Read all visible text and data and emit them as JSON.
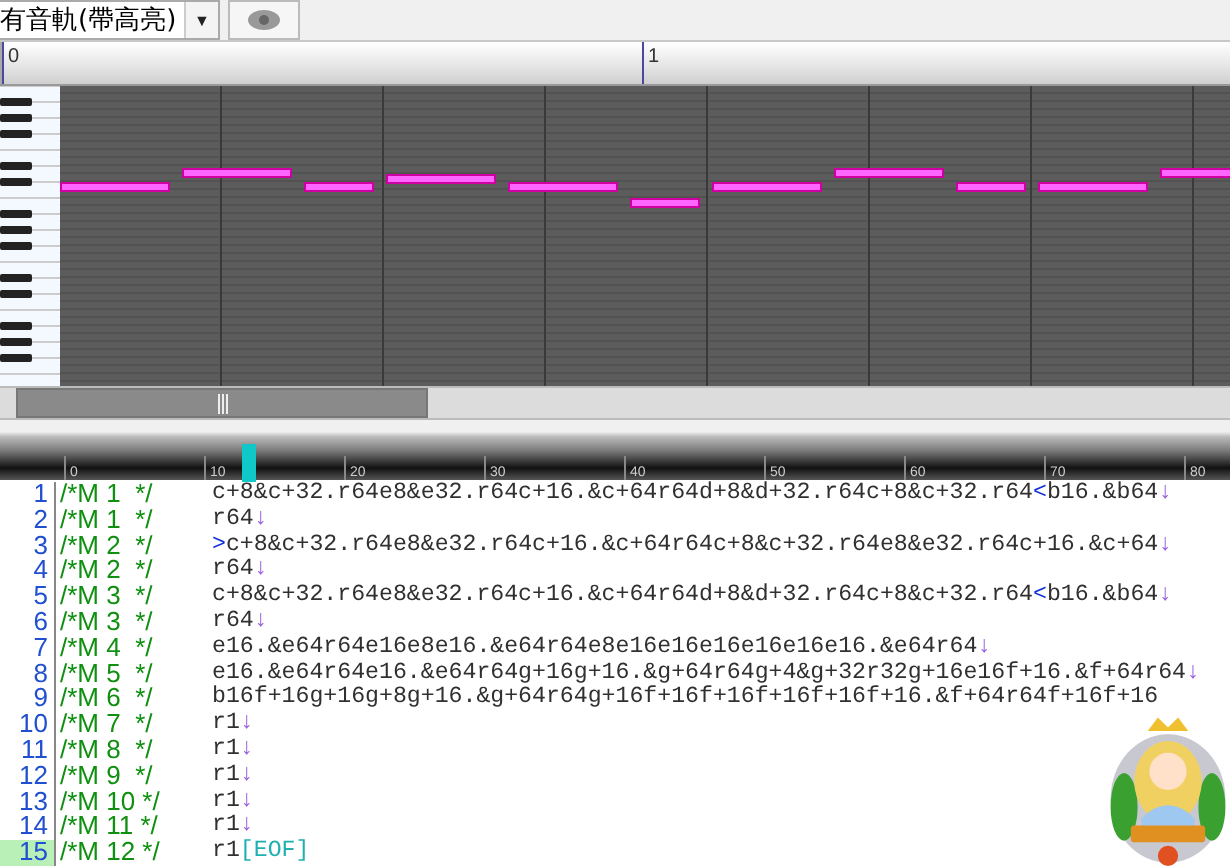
{
  "toolbar": {
    "track_filter": "有音軌(帶高亮)",
    "dropdown_arrow": "▼"
  },
  "piano_roll": {
    "measures": [
      "0",
      "1"
    ]
  },
  "editor": {
    "ruler": [
      "0",
      "10",
      "20",
      "30",
      "40",
      "50",
      "60",
      "70",
      "80"
    ],
    "lines": [
      {
        "number": "1",
        "comment": "/*M 1  */",
        "selected": false,
        "segments": [
          {
            "kind": "mml",
            "text": "c+8&c+32.r64e8&e32.r64c+16.&c+64r64d+8&d+32.r64c+8&c+32.r64"
          },
          {
            "kind": "octave",
            "text": "<"
          },
          {
            "kind": "mml",
            "text": "b16.&b64"
          },
          {
            "kind": "eol",
            "text": "↓"
          }
        ]
      },
      {
        "number": "2",
        "comment": "/*M 1  */",
        "selected": false,
        "segments": [
          {
            "kind": "mml",
            "text": "r64"
          },
          {
            "kind": "eol",
            "text": "↓"
          }
        ]
      },
      {
        "number": "3",
        "comment": "/*M 2  */",
        "selected": false,
        "segments": [
          {
            "kind": "octave",
            "text": ">"
          },
          {
            "kind": "mml",
            "text": "c+8&c+32.r64e8&e32.r64c+16.&c+64r64c+8&c+32.r64e8&e32.r64c+16.&c+64"
          },
          {
            "kind": "eol",
            "text": "↓"
          }
        ]
      },
      {
        "number": "4",
        "comment": "/*M 2  */",
        "selected": false,
        "segments": [
          {
            "kind": "mml",
            "text": "r64"
          },
          {
            "kind": "eol",
            "text": "↓"
          }
        ]
      },
      {
        "number": "5",
        "comment": "/*M 3  */",
        "selected": false,
        "segments": [
          {
            "kind": "mml",
            "text": "c+8&c+32.r64e8&e32.r64c+16.&c+64r64d+8&d+32.r64c+8&c+32.r64"
          },
          {
            "kind": "octave",
            "text": "<"
          },
          {
            "kind": "mml",
            "text": "b16.&b64"
          },
          {
            "kind": "eol",
            "text": "↓"
          }
        ]
      },
      {
        "number": "6",
        "comment": "/*M 3  */",
        "selected": false,
        "segments": [
          {
            "kind": "mml",
            "text": "r64"
          },
          {
            "kind": "eol",
            "text": "↓"
          }
        ]
      },
      {
        "number": "7",
        "comment": "/*M 4  */",
        "selected": false,
        "segments": [
          {
            "kind": "mml",
            "text": "e16.&e64r64e16e8e16.&e64r64e8e16e16e16e16e16e16.&e64r64"
          },
          {
            "kind": "eol",
            "text": "↓"
          }
        ]
      },
      {
        "number": "8",
        "comment": "/*M 5  */",
        "selected": false,
        "segments": [
          {
            "kind": "mml",
            "text": "e16.&e64r64e16.&e64r64g+16g+16.&g+64r64g+4&g+32r32g+16e16f+16.&f+64r64"
          },
          {
            "kind": "eol",
            "text": "↓"
          }
        ]
      },
      {
        "number": "9",
        "comment": "/*M 6  */",
        "selected": false,
        "segments": [
          {
            "kind": "mml",
            "text": "b16f+16g+16g+8g+16.&g+64r64g+16f+16f+16f+16f+16f+16.&f+64r64f+16f+16"
          }
        ]
      },
      {
        "number": "10",
        "comment": "/*M 7  */",
        "selected": false,
        "segments": [
          {
            "kind": "mml",
            "text": "r1"
          },
          {
            "kind": "eol",
            "text": "↓"
          }
        ]
      },
      {
        "number": "11",
        "comment": "/*M 8  */",
        "selected": false,
        "segments": [
          {
            "kind": "mml",
            "text": "r1"
          },
          {
            "kind": "eol",
            "text": "↓"
          }
        ]
      },
      {
        "number": "12",
        "comment": "/*M 9  */",
        "selected": false,
        "segments": [
          {
            "kind": "mml",
            "text": "r1"
          },
          {
            "kind": "eol",
            "text": "↓"
          }
        ]
      },
      {
        "number": "13",
        "comment": "/*M 10 */",
        "selected": false,
        "segments": [
          {
            "kind": "mml",
            "text": "r1"
          },
          {
            "kind": "eol",
            "text": "↓"
          }
        ]
      },
      {
        "number": "14",
        "comment": "/*M 11 */",
        "selected": false,
        "segments": [
          {
            "kind": "mml",
            "text": "r1"
          },
          {
            "kind": "eol",
            "text": "↓"
          }
        ]
      },
      {
        "number": "15",
        "comment": "/*M 12 */",
        "selected": true,
        "segments": [
          {
            "kind": "mml",
            "text": "r1"
          },
          {
            "kind": "eof",
            "text": "[EOF]"
          }
        ]
      }
    ]
  }
}
